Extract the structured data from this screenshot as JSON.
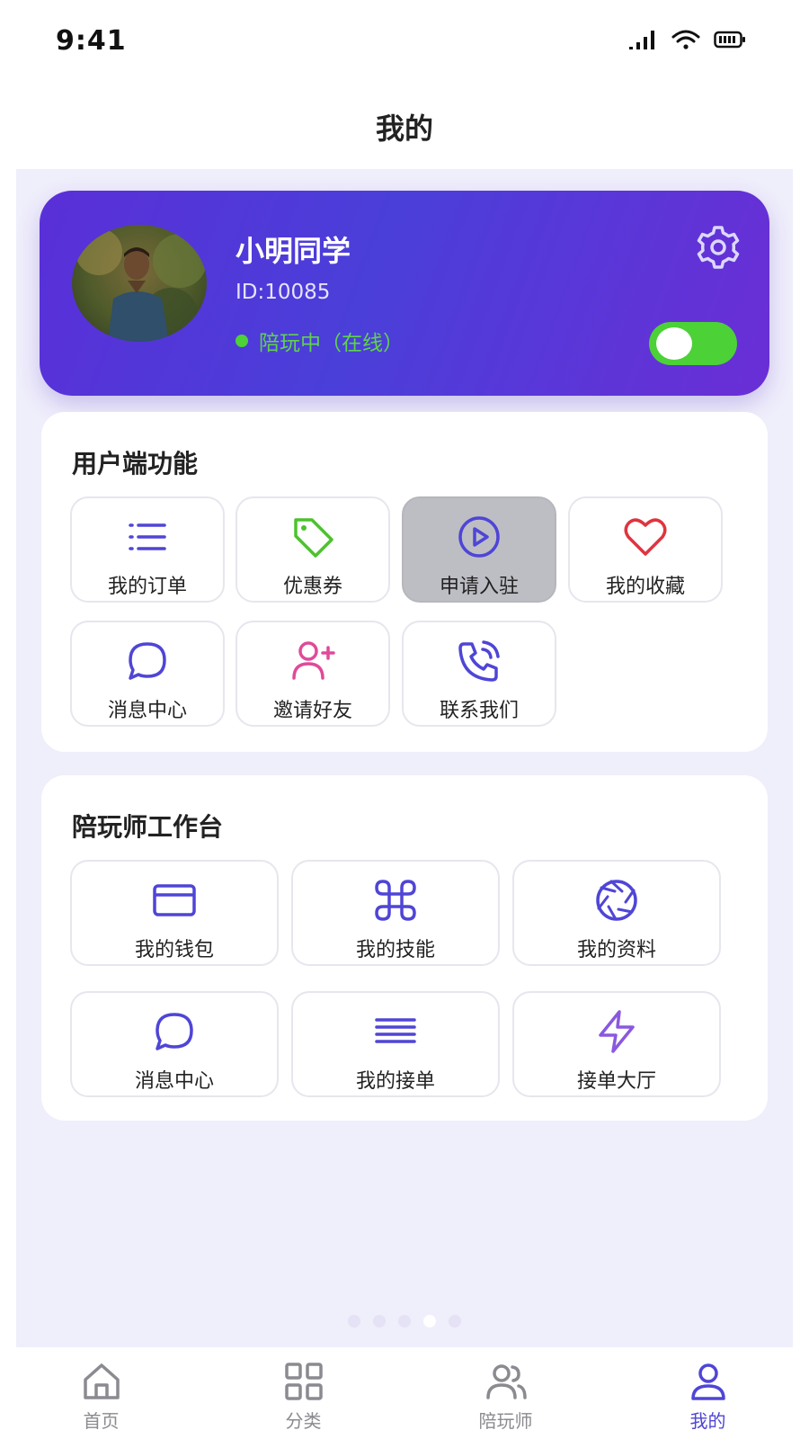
{
  "status_bar": {
    "time": "9:41"
  },
  "page": {
    "title": "我的"
  },
  "profile": {
    "name": "小明同学",
    "id": "ID:10085",
    "status": "陪玩中（在线）",
    "toggle_on": true
  },
  "user_section": {
    "title": "用户端功能",
    "items": [
      {
        "label": "我的订单",
        "icon": "list-icon"
      },
      {
        "label": "优惠券",
        "icon": "tag-icon"
      },
      {
        "label": "申请入驻",
        "icon": "play-circle-icon"
      },
      {
        "label": "我的收藏",
        "icon": "heart-icon"
      },
      {
        "label": "消息中心",
        "icon": "chat-bubble-icon"
      },
      {
        "label": "邀请好友",
        "icon": "user-plus-icon"
      },
      {
        "label": "联系我们",
        "icon": "phone-call-icon"
      }
    ]
  },
  "companion_section": {
    "title": "陪玩师工作台",
    "items": [
      {
        "label": "我的钱包",
        "icon": "wallet-card-icon"
      },
      {
        "label": "我的技能",
        "icon": "command-icon"
      },
      {
        "label": "我的资料",
        "icon": "aperture-icon"
      },
      {
        "label": "消息中心",
        "icon": "chat-bubble-icon"
      },
      {
        "label": "我的接单",
        "icon": "lines-icon"
      },
      {
        "label": "接单大厅",
        "icon": "lightning-icon"
      }
    ]
  },
  "tabbar": {
    "items": [
      {
        "label": "首页",
        "icon": "home-icon"
      },
      {
        "label": "分类",
        "icon": "grid-icon"
      },
      {
        "label": "陪玩师",
        "icon": "users-icon"
      },
      {
        "label": "我的",
        "icon": "user-icon"
      }
    ],
    "active_index": 3
  },
  "colors": {
    "accent": "#4f45d6",
    "online": "#4cd137",
    "card_gradient_start": "#5a2fd8",
    "card_gradient_end": "#6a2ed6",
    "page_bg": "#efeefb"
  }
}
